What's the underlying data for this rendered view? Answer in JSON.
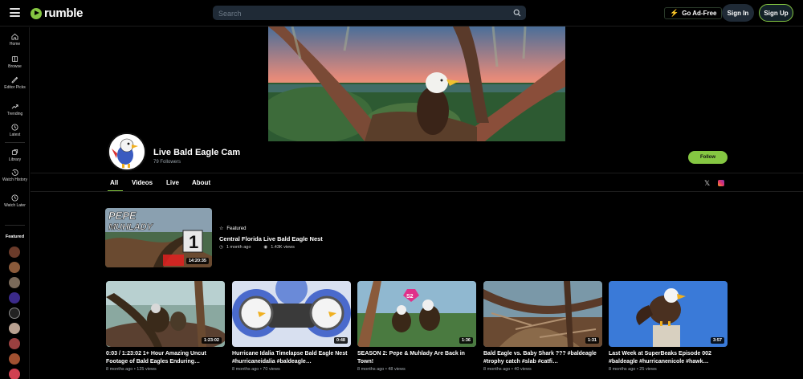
{
  "header": {
    "logo_text": "rumble",
    "search_placeholder": "Search",
    "go_adfree_label": "Go Ad-Free",
    "signin_label": "Sign In",
    "signup_label": "Sign Up"
  },
  "sidebar": {
    "items": [
      {
        "label": "Home",
        "icon": "home-icon"
      },
      {
        "label": "Browse",
        "icon": "browse-icon"
      },
      {
        "label": "Editor Picks",
        "icon": "editor-picks-icon"
      },
      {
        "label": "Trending",
        "icon": "trending-icon"
      },
      {
        "label": "Latest",
        "icon": "clock-icon"
      },
      {
        "label": "Library",
        "icon": "library-icon"
      },
      {
        "label": "Watch History",
        "icon": "history-icon"
      },
      {
        "label": "Watch Later",
        "icon": "watch-later-icon"
      }
    ],
    "featured_label": "Featured"
  },
  "channel": {
    "name": "Live Bald Eagle Cam",
    "followers": "79 Followers",
    "follow_label": "Follow"
  },
  "tabs": [
    {
      "label": "All",
      "active": true
    },
    {
      "label": "Videos",
      "active": false
    },
    {
      "label": "Live",
      "active": false
    },
    {
      "label": "About",
      "active": false
    }
  ],
  "featured_video": {
    "badge": "Featured",
    "title": "Central Florida Live Bald Eagle Nest",
    "age": "1 month ago",
    "views": "1.43K views",
    "duration": "14:20:35",
    "thumb_text_1": "PEPE",
    "thumb_text_2": "MUHLADY",
    "thumb_number": "1"
  },
  "videos": [
    {
      "title": "0:03 / 1:23:02 1+ Hour Amazing Uncut Footage of Bald Eagles Enduring…",
      "meta": "8 months ago • 125 views",
      "duration": "1:23:02"
    },
    {
      "title": "Hurricane Idalia Timelapse Bald Eagle Nest #hurricaneidalia #baldeagle…",
      "meta": "8 months ago • 70 views",
      "duration": "0:48"
    },
    {
      "title": "SEASON 2: Pepe & Muhlady Are Back in Town!",
      "meta": "8 months ago • 48 views",
      "duration": "1:36"
    },
    {
      "title": "Bald Eagle vs. Baby Shark ??? #baldeagle #trophy catch #slab #catfi…",
      "meta": "8 months ago • 40 views",
      "duration": "1:31"
    },
    {
      "title": "Last Week at SuperBeaks Episode 002 #baldeagle #hurricanenicole #hawk…",
      "meta": "8 months ago • 25 views",
      "duration": "3:57"
    }
  ],
  "colors": {
    "accent": "#85c742",
    "search_bg": "#1f2a36",
    "background": "#000000"
  }
}
